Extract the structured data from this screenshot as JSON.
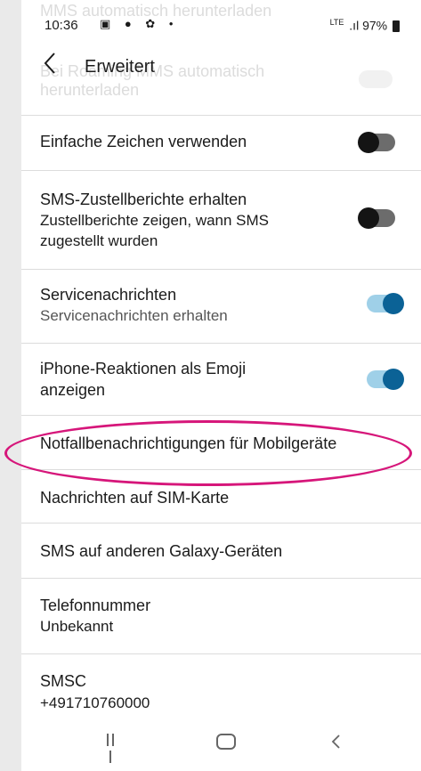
{
  "status_bar": {
    "time": "10:36",
    "icons": "▣ ● ✿ •",
    "network": "LTE",
    "signal": ".ıl",
    "battery": "97%"
  },
  "ghost_rows": {
    "line1": "MMS automatisch herunterladen",
    "line2": "Bei Roaming MMS automatisch",
    "line3": "herunterladen"
  },
  "header": {
    "back_icon": "chevron-left-icon",
    "title": "Erweitert"
  },
  "settings": [
    {
      "primary": "Einfache Zeichen verwenden",
      "toggle": "off"
    },
    {
      "primary": "SMS-Zustellberichte erhalten",
      "secondary_1": "Zustellberichte zeigen, wann SMS",
      "secondary_2": "zugestellt wurden",
      "toggle": "off"
    },
    {
      "primary": "Servicenachrichten",
      "secondary": "Servicenachrichten erhalten",
      "toggle": "on"
    },
    {
      "primary_1": "iPhone-Reaktionen als Emoji",
      "primary_2": "anzeigen",
      "toggle": "on"
    },
    {
      "primary": "Notfallbenachrichtigungen für Mobilgeräte"
    },
    {
      "primary": "Nachrichten auf SIM-Karte"
    },
    {
      "primary": "SMS auf anderen Galaxy-Geräten"
    },
    {
      "primary": "Telefonnummer",
      "secondary": "Unbekannt"
    },
    {
      "primary": "SMSC",
      "secondary": "+491710760000"
    }
  ],
  "colors": {
    "toggle_on_track": "#9fd0e8",
    "toggle_on_knob": "#0b6296",
    "toggle_off_track": "#6c6c6c",
    "toggle_off_knob": "#141414",
    "highlight": "#d6167a"
  },
  "navbar": {
    "recents_icon": "recents-icon",
    "home_icon": "home-icon",
    "back_icon": "back-nav-icon"
  }
}
